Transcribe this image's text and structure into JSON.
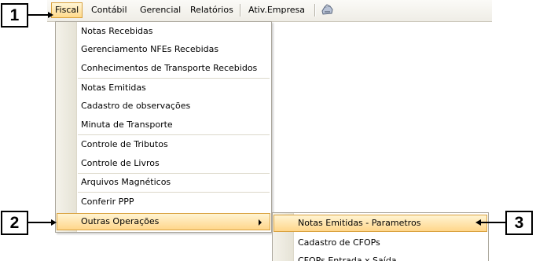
{
  "menubar": {
    "items": [
      "Fiscal",
      "Contábil",
      "Gerencial",
      "Relatórios",
      "Ativ.Empresa"
    ],
    "active": "Fiscal",
    "icon": "printer-icon"
  },
  "fiscal_menu": {
    "items": [
      "Notas Recebidas",
      "Gerenciamento NFEs Recebidas",
      "Conhecimentos de Transporte Recebidos",
      "Notas Emitidas",
      "Cadastro de observações",
      "Minuta de Transporte",
      "Controle de Tributos",
      "Controle de Livros",
      "Arquivos Magnéticos",
      "Conferir PPP",
      "Outras Operações"
    ],
    "highlighted": "Outras Operações"
  },
  "submenu": {
    "items": [
      "Notas Emitidas - Parametros",
      "Cadastro de CFOPs",
      "CFOPs Entrada x Saída"
    ],
    "highlighted": "Notas Emitidas - Parametros"
  },
  "callouts": [
    "1",
    "2",
    "3"
  ],
  "colors": {
    "highlight": "#ffd98a",
    "highlight_border": "#d9a23f"
  }
}
